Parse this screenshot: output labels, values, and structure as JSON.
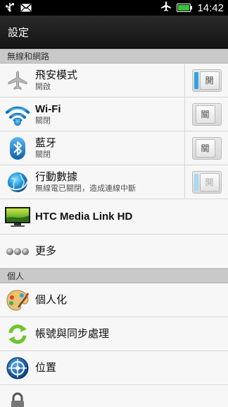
{
  "status_bar": {
    "time": "14:42"
  },
  "title_bar": {
    "title": "設定"
  },
  "sections": [
    {
      "header": "無線和網路"
    },
    {
      "header": "個人"
    }
  ],
  "rows": {
    "airplane": {
      "title": "飛安模式",
      "subtitle": "開啟",
      "toggle_label": "開"
    },
    "wifi": {
      "title": "Wi-Fi",
      "subtitle": "關閉",
      "toggle_label": "關"
    },
    "bluetooth": {
      "title": "藍牙",
      "subtitle": "關閉",
      "toggle_label": "關"
    },
    "mobile": {
      "title": "行動數據",
      "subtitle": "無線電已關閉，造成連線中斷",
      "toggle_label": "開"
    },
    "media_link": {
      "title": "HTC Media Link HD"
    },
    "more": {
      "title": "更多"
    },
    "personalize": {
      "title": "個人化"
    },
    "accounts": {
      "title": "帳號與同步處理"
    },
    "location": {
      "title": "位置"
    }
  },
  "colors": {
    "accent": "#2fa4e0"
  }
}
